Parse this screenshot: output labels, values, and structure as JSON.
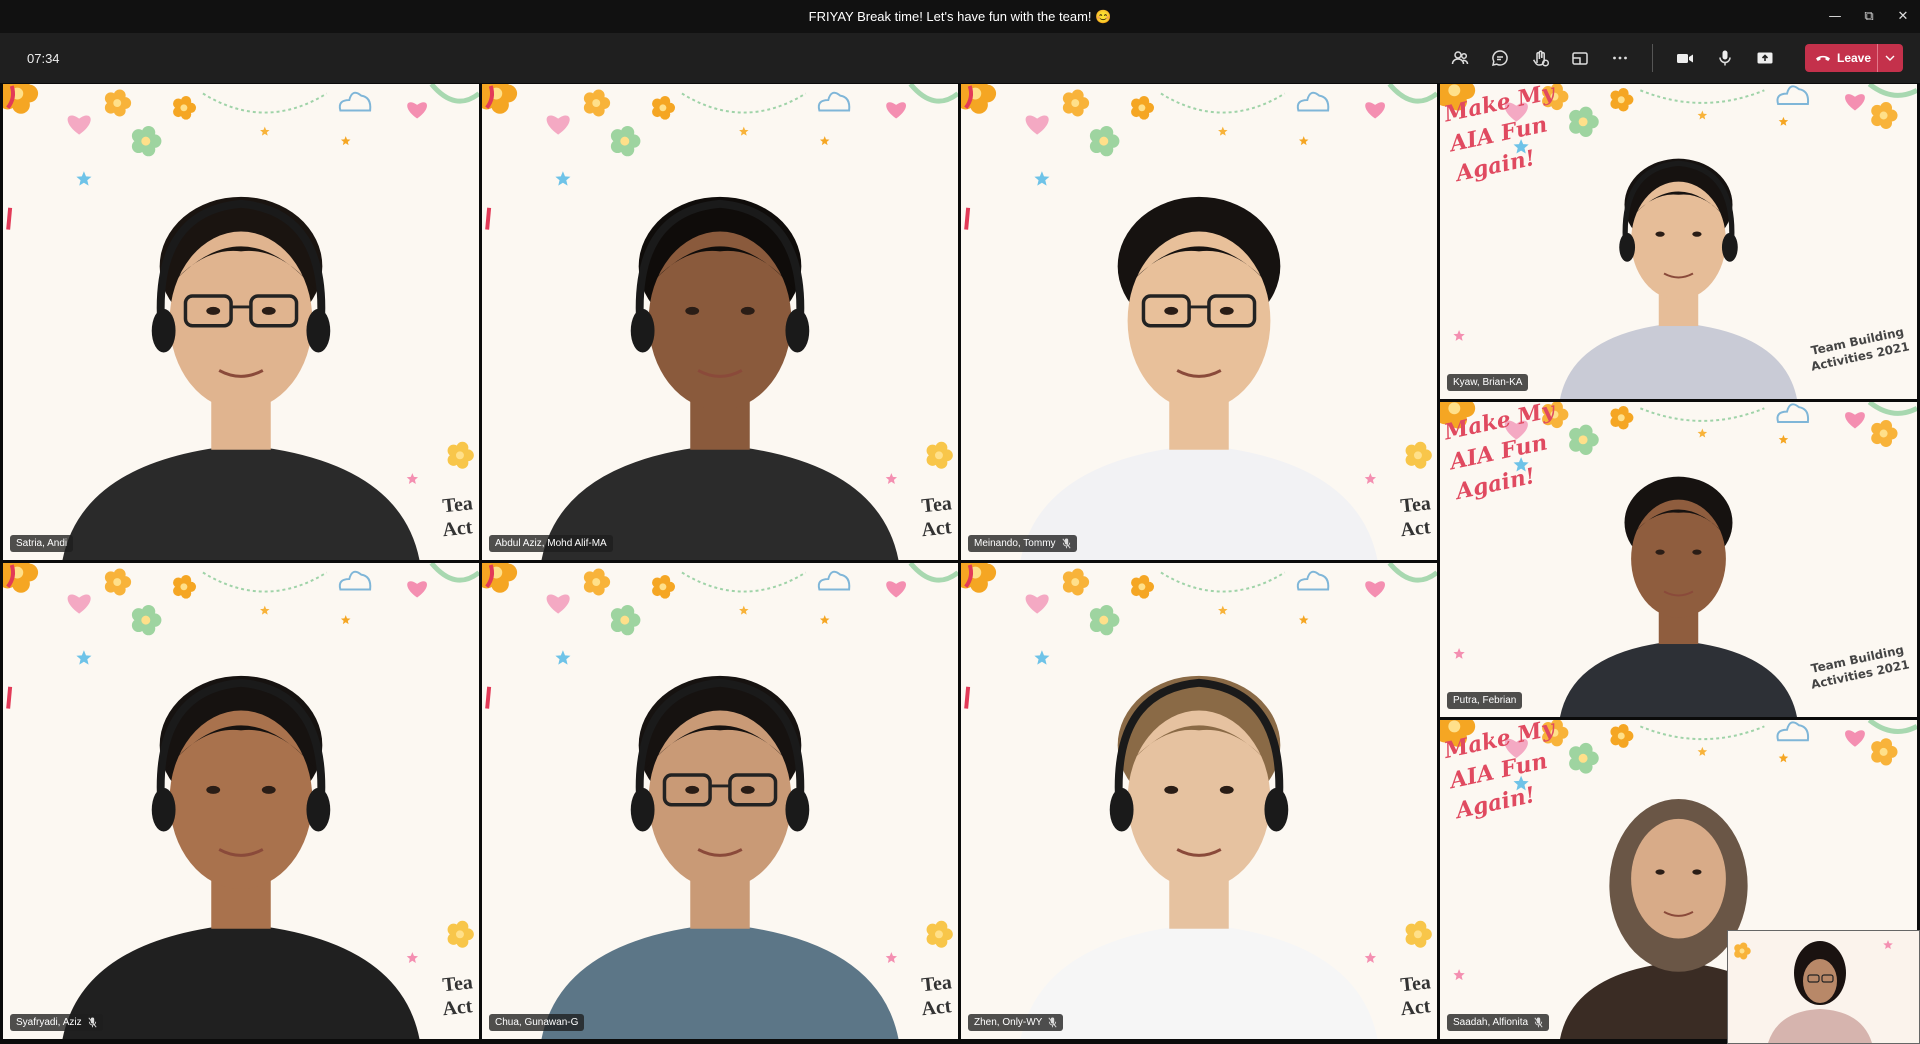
{
  "window": {
    "title": "FRIYAY Break time! Let's have fun with the team! 😊",
    "controls": [
      "minimize",
      "restore",
      "close"
    ]
  },
  "meeting": {
    "elapsed": "07:34",
    "toolbar": {
      "icons": [
        "people-icon",
        "chat-icon",
        "reactions-icon",
        "rooms-icon",
        "more-icon",
        "camera-icon",
        "mic-icon",
        "share-icon"
      ],
      "leave_label": "Leave"
    },
    "colors": {
      "leave": "#c4314b",
      "bar": "#1f1f1f",
      "titlebar": "#111111"
    }
  },
  "participants": [
    {
      "name": "Satria, Andi",
      "muted": false,
      "shirt": "#2a2a2a",
      "hair": "#1a1410",
      "skin": "#e0b48f",
      "glasses": true,
      "headset": true,
      "bg": "confetti"
    },
    {
      "name": "Abdul Aziz, Mohd Alif-MA",
      "muted": false,
      "shirt": "#2b2b2b",
      "hair": "#0f0c0a",
      "skin": "#8a5a3c",
      "glasses": false,
      "headset": true,
      "bg": "confetti"
    },
    {
      "name": "Meinando, Tommy",
      "muted": true,
      "shirt": "#f2f2f4",
      "hair": "#161210",
      "skin": "#e8c09a",
      "glasses": true,
      "headset": false,
      "bg": "confetti"
    },
    {
      "name": "Kyaw, Brian-KA",
      "muted": false,
      "shirt": "#c9cbd6",
      "hair": "#161210",
      "skin": "#e6bd98",
      "glasses": false,
      "headset": true,
      "bg": "fun"
    },
    {
      "name": "Putra, Febrian",
      "muted": false,
      "shirt": "#2d3036",
      "hair": "#161210",
      "skin": "#8f5d3e",
      "glasses": false,
      "headset": false,
      "bg": "fun"
    },
    {
      "name": "Syafryadi, Aziz",
      "muted": true,
      "shirt": "#202020",
      "hair": "#161210",
      "skin": "#a9724d",
      "glasses": false,
      "headset": true,
      "bg": "confetti"
    },
    {
      "name": "Chua, Gunawan-G",
      "muted": false,
      "shirt": "#5c7687",
      "hair": "#161210",
      "skin": "#c99a76",
      "glasses": true,
      "headset": true,
      "bg": "confetti"
    },
    {
      "name": "Zhen, Only-WY",
      "muted": true,
      "shirt": "#f6f6f6",
      "hair": "#8a6a46",
      "skin": "#e6c2a0",
      "glasses": false,
      "headset": true,
      "bg": "confetti"
    },
    {
      "name": "Saadah, Alfionita",
      "muted": true,
      "shirt": "#3a2c24",
      "hair": "#6a5646",
      "skin": "#d8ab88",
      "glasses": false,
      "headset": false,
      "bg": "fun",
      "hijab": true
    }
  ],
  "self_view": {
    "skin": "#b88868",
    "hair": "#1a1210",
    "shirt": "#d6b4ae"
  },
  "background_text": {
    "fun_lines": [
      "Make My",
      "AIA Fun",
      "Again!"
    ],
    "team_lines": [
      "Team Building",
      "Activities 2021"
    ],
    "team_short": [
      "Tea",
      "Act"
    ]
  }
}
